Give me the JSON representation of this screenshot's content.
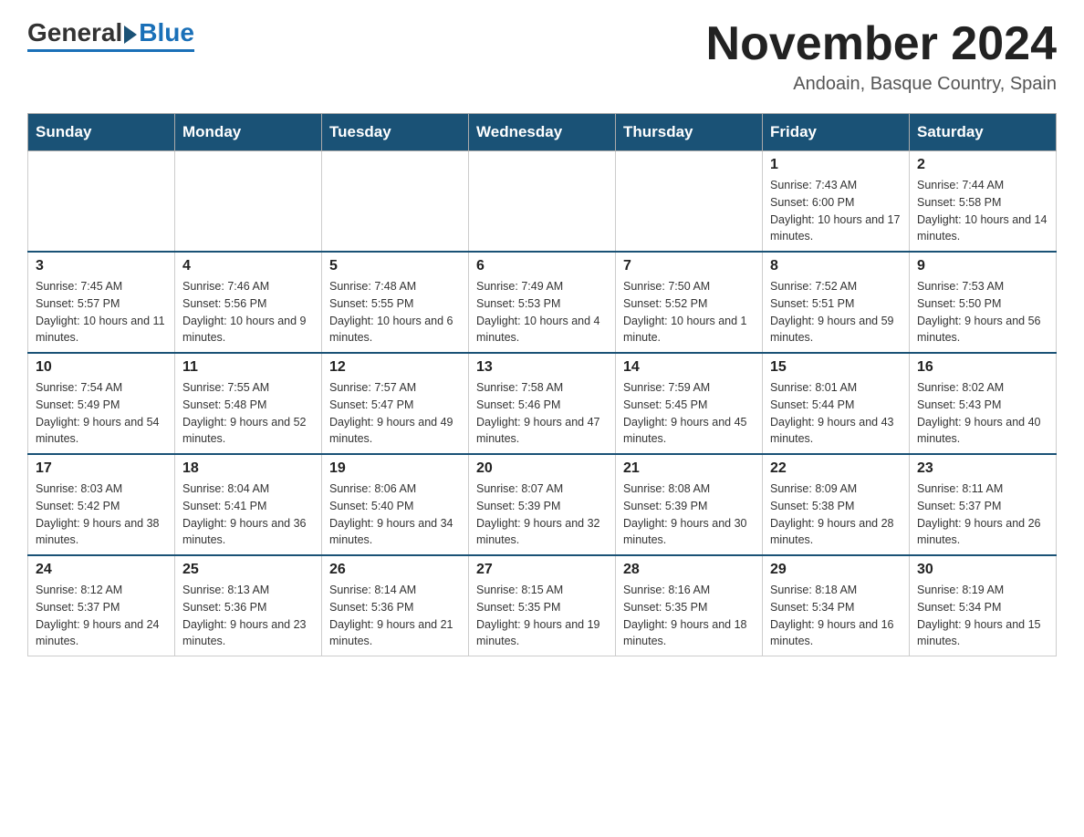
{
  "logo": {
    "general": "General",
    "blue": "Blue"
  },
  "header": {
    "month_title": "November 2024",
    "location": "Andoain, Basque Country, Spain"
  },
  "days_of_week": [
    "Sunday",
    "Monday",
    "Tuesday",
    "Wednesday",
    "Thursday",
    "Friday",
    "Saturday"
  ],
  "weeks": [
    [
      {
        "day": "",
        "sunrise": "",
        "sunset": "",
        "daylight": ""
      },
      {
        "day": "",
        "sunrise": "",
        "sunset": "",
        "daylight": ""
      },
      {
        "day": "",
        "sunrise": "",
        "sunset": "",
        "daylight": ""
      },
      {
        "day": "",
        "sunrise": "",
        "sunset": "",
        "daylight": ""
      },
      {
        "day": "",
        "sunrise": "",
        "sunset": "",
        "daylight": ""
      },
      {
        "day": "1",
        "sunrise": "Sunrise: 7:43 AM",
        "sunset": "Sunset: 6:00 PM",
        "daylight": "Daylight: 10 hours and 17 minutes."
      },
      {
        "day": "2",
        "sunrise": "Sunrise: 7:44 AM",
        "sunset": "Sunset: 5:58 PM",
        "daylight": "Daylight: 10 hours and 14 minutes."
      }
    ],
    [
      {
        "day": "3",
        "sunrise": "Sunrise: 7:45 AM",
        "sunset": "Sunset: 5:57 PM",
        "daylight": "Daylight: 10 hours and 11 minutes."
      },
      {
        "day": "4",
        "sunrise": "Sunrise: 7:46 AM",
        "sunset": "Sunset: 5:56 PM",
        "daylight": "Daylight: 10 hours and 9 minutes."
      },
      {
        "day": "5",
        "sunrise": "Sunrise: 7:48 AM",
        "sunset": "Sunset: 5:55 PM",
        "daylight": "Daylight: 10 hours and 6 minutes."
      },
      {
        "day": "6",
        "sunrise": "Sunrise: 7:49 AM",
        "sunset": "Sunset: 5:53 PM",
        "daylight": "Daylight: 10 hours and 4 minutes."
      },
      {
        "day": "7",
        "sunrise": "Sunrise: 7:50 AM",
        "sunset": "Sunset: 5:52 PM",
        "daylight": "Daylight: 10 hours and 1 minute."
      },
      {
        "day": "8",
        "sunrise": "Sunrise: 7:52 AM",
        "sunset": "Sunset: 5:51 PM",
        "daylight": "Daylight: 9 hours and 59 minutes."
      },
      {
        "day": "9",
        "sunrise": "Sunrise: 7:53 AM",
        "sunset": "Sunset: 5:50 PM",
        "daylight": "Daylight: 9 hours and 56 minutes."
      }
    ],
    [
      {
        "day": "10",
        "sunrise": "Sunrise: 7:54 AM",
        "sunset": "Sunset: 5:49 PM",
        "daylight": "Daylight: 9 hours and 54 minutes."
      },
      {
        "day": "11",
        "sunrise": "Sunrise: 7:55 AM",
        "sunset": "Sunset: 5:48 PM",
        "daylight": "Daylight: 9 hours and 52 minutes."
      },
      {
        "day": "12",
        "sunrise": "Sunrise: 7:57 AM",
        "sunset": "Sunset: 5:47 PM",
        "daylight": "Daylight: 9 hours and 49 minutes."
      },
      {
        "day": "13",
        "sunrise": "Sunrise: 7:58 AM",
        "sunset": "Sunset: 5:46 PM",
        "daylight": "Daylight: 9 hours and 47 minutes."
      },
      {
        "day": "14",
        "sunrise": "Sunrise: 7:59 AM",
        "sunset": "Sunset: 5:45 PM",
        "daylight": "Daylight: 9 hours and 45 minutes."
      },
      {
        "day": "15",
        "sunrise": "Sunrise: 8:01 AM",
        "sunset": "Sunset: 5:44 PM",
        "daylight": "Daylight: 9 hours and 43 minutes."
      },
      {
        "day": "16",
        "sunrise": "Sunrise: 8:02 AM",
        "sunset": "Sunset: 5:43 PM",
        "daylight": "Daylight: 9 hours and 40 minutes."
      }
    ],
    [
      {
        "day": "17",
        "sunrise": "Sunrise: 8:03 AM",
        "sunset": "Sunset: 5:42 PM",
        "daylight": "Daylight: 9 hours and 38 minutes."
      },
      {
        "day": "18",
        "sunrise": "Sunrise: 8:04 AM",
        "sunset": "Sunset: 5:41 PM",
        "daylight": "Daylight: 9 hours and 36 minutes."
      },
      {
        "day": "19",
        "sunrise": "Sunrise: 8:06 AM",
        "sunset": "Sunset: 5:40 PM",
        "daylight": "Daylight: 9 hours and 34 minutes."
      },
      {
        "day": "20",
        "sunrise": "Sunrise: 8:07 AM",
        "sunset": "Sunset: 5:39 PM",
        "daylight": "Daylight: 9 hours and 32 minutes."
      },
      {
        "day": "21",
        "sunrise": "Sunrise: 8:08 AM",
        "sunset": "Sunset: 5:39 PM",
        "daylight": "Daylight: 9 hours and 30 minutes."
      },
      {
        "day": "22",
        "sunrise": "Sunrise: 8:09 AM",
        "sunset": "Sunset: 5:38 PM",
        "daylight": "Daylight: 9 hours and 28 minutes."
      },
      {
        "day": "23",
        "sunrise": "Sunrise: 8:11 AM",
        "sunset": "Sunset: 5:37 PM",
        "daylight": "Daylight: 9 hours and 26 minutes."
      }
    ],
    [
      {
        "day": "24",
        "sunrise": "Sunrise: 8:12 AM",
        "sunset": "Sunset: 5:37 PM",
        "daylight": "Daylight: 9 hours and 24 minutes."
      },
      {
        "day": "25",
        "sunrise": "Sunrise: 8:13 AM",
        "sunset": "Sunset: 5:36 PM",
        "daylight": "Daylight: 9 hours and 23 minutes."
      },
      {
        "day": "26",
        "sunrise": "Sunrise: 8:14 AM",
        "sunset": "Sunset: 5:36 PM",
        "daylight": "Daylight: 9 hours and 21 minutes."
      },
      {
        "day": "27",
        "sunrise": "Sunrise: 8:15 AM",
        "sunset": "Sunset: 5:35 PM",
        "daylight": "Daylight: 9 hours and 19 minutes."
      },
      {
        "day": "28",
        "sunrise": "Sunrise: 8:16 AM",
        "sunset": "Sunset: 5:35 PM",
        "daylight": "Daylight: 9 hours and 18 minutes."
      },
      {
        "day": "29",
        "sunrise": "Sunrise: 8:18 AM",
        "sunset": "Sunset: 5:34 PM",
        "daylight": "Daylight: 9 hours and 16 minutes."
      },
      {
        "day": "30",
        "sunrise": "Sunrise: 8:19 AM",
        "sunset": "Sunset: 5:34 PM",
        "daylight": "Daylight: 9 hours and 15 minutes."
      }
    ]
  ]
}
